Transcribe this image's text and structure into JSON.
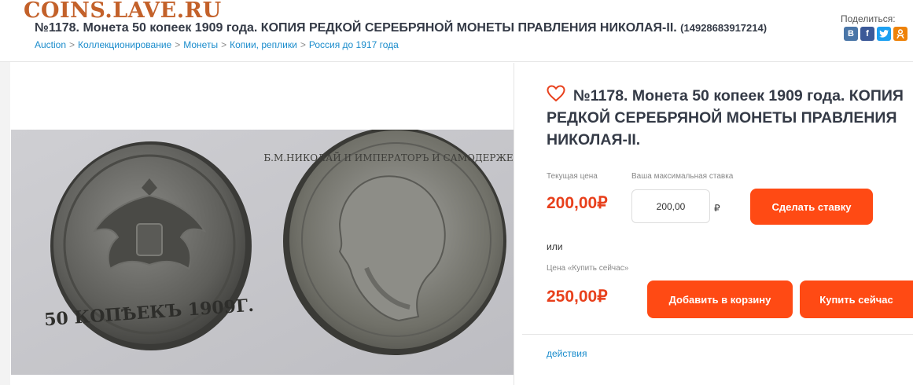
{
  "site": {
    "watermark": "COINS.LAVE.RU"
  },
  "header": {
    "title": "№1178. Монета 50 копеек 1909 года. КОПИЯ РЕДКОЙ СЕРЕБРЯНОЙ МОНЕТЫ ПРАВЛЕНИЯ НИКОЛАЯ-II.",
    "lot_id": "(14928683917214)"
  },
  "breadcrumb": [
    "Auction",
    "Коллекционирование",
    "Монеты",
    "Копии, реплики",
    "Россия до 1917 года"
  ],
  "share": {
    "label": "Поделиться:",
    "icons": [
      "vk-icon",
      "facebook-icon",
      "twitter-icon",
      "odnoklassniki-icon"
    ]
  },
  "lot": {
    "title": "№1178. Монета 50 копеек 1909 года. КОПИЯ РЕДКОЙ СЕРЕБРЯНОЙ МОНЕТЫ ПРАВЛЕНИЯ НИКОЛАЯ-II.",
    "current_price_label": "Текущая цена",
    "current_price": "200,00",
    "max_bid_label": "Ваша максимальная ставка",
    "max_bid_value": "200,00",
    "currency": "₽",
    "bid_button": "Сделать ставку",
    "or": "или",
    "buy_now_label": "Цена «Купить сейчас»",
    "buy_now_price": "250,00",
    "add_to_cart_button": "Добавить в корзину",
    "buy_now_button": "Купить сейчас",
    "actions_link": "действия"
  },
  "colors": {
    "accent": "#ff4a14",
    "price": "#e8401c",
    "link": "#1a8ccc",
    "watermark": "#c3612a"
  }
}
